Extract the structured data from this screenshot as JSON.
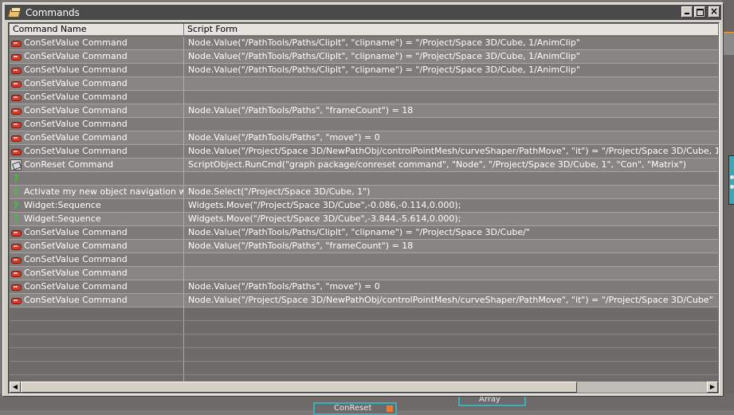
{
  "window": {
    "title": "Commands"
  },
  "table": {
    "columns": [
      "Command Name",
      "Script Form"
    ],
    "rows": [
      {
        "icon": "con",
        "name": "ConSetValue Command",
        "script": "Node.Value(\"/PathTools/Paths/ClipIt\", \"clipname\") = \"/Project/Space 3D/Cube, 1/AnimClip\""
      },
      {
        "icon": "con",
        "name": "ConSetValue Command",
        "script": "Node.Value(\"/PathTools/Paths/ClipIt\", \"clipname\") = \"/Project/Space 3D/Cube, 1/AnimClip\""
      },
      {
        "icon": "con",
        "name": "ConSetValue Command",
        "script": "Node.Value(\"/PathTools/Paths/ClipIt\", \"clipname\") = \"/Project/Space 3D/Cube, 1/AnimClip\""
      },
      {
        "icon": "con",
        "name": "ConSetValue Command",
        "script": ""
      },
      {
        "icon": "con",
        "name": "ConSetValue Command",
        "script": ""
      },
      {
        "icon": "con",
        "name": "ConSetValue Command",
        "script": "Node.Value(\"/PathTools/Paths\", \"frameCount\") = 18"
      },
      {
        "icon": "con",
        "name": "ConSetValue Command",
        "script": ""
      },
      {
        "icon": "con",
        "name": "ConSetValue Command",
        "script": "Node.Value(\"/PathTools/Paths\", \"move\") = 0"
      },
      {
        "icon": "con",
        "name": "ConSetValue Command",
        "script": "Node.Value(\"/Project/Space 3D/NewPathObj/controlPointMesh/curveShaper/PathMove\", \"it\") = \"/Project/Space 3D/Cube, 1\""
      },
      {
        "icon": "reset",
        "name": "ConReset Command",
        "script": "ScriptObject.RunCmd(\"graph package/conreset command\", \"Node\", \"/Project/Space 3D/Cube, 1\", \"Con\", \"Matrix\")"
      },
      {
        "icon": "q",
        "name": "",
        "script": ""
      },
      {
        "icon": "q",
        "name": "Activate my new object navigation widget",
        "script": "Node.Select(\"/Project/Space 3D/Cube, 1\")"
      },
      {
        "icon": "q",
        "name": "Widget:Sequence",
        "script": "Widgets.Move(\"/Project/Space 3D/Cube\",-0.086,-0.114,0.000);"
      },
      {
        "icon": "q",
        "name": "Widget:Sequence",
        "script": "Widgets.Move(\"/Project/Space 3D/Cube\",-3.844,-5.614,0.000);"
      },
      {
        "icon": "con",
        "name": "ConSetValue Command",
        "script": "Node.Value(\"/PathTools/Paths/ClipIt\", \"clipname\") = \"/Project/Space 3D/Cube/\""
      },
      {
        "icon": "con",
        "name": "ConSetValue Command",
        "script": "Node.Value(\"/PathTools/Paths\", \"frameCount\") = 18"
      },
      {
        "icon": "con",
        "name": "ConSetValue Command",
        "script": ""
      },
      {
        "icon": "con",
        "name": "ConSetValue Command",
        "script": ""
      },
      {
        "icon": "con",
        "name": "ConSetValue Command",
        "script": "Node.Value(\"/PathTools/Paths\", \"move\") = 0"
      },
      {
        "icon": "con",
        "name": "ConSetValue Command",
        "script": "Node.Value(\"/Project/Space 3D/NewPathObj/controlPointMesh/curveShaper/PathMove\", \"it\") = \"/Project/Space 3D/Cube\""
      }
    ],
    "empty_rows": 6
  },
  "background": {
    "node_array_label": "Array",
    "node_bottom_label": "ConReset"
  },
  "icons": {
    "window": "commands-window-icon",
    "con": "con-command-icon",
    "reset": "reset-command-icon",
    "q": "question-mark-icon"
  },
  "colors": {
    "titlebar": "#4a4a4a",
    "row_odd": "#7f7a7a",
    "row_even": "#8a8585",
    "question_icon": "#3ec43a",
    "con_icon": "#d63a2a",
    "node_border": "#3bb0b8"
  }
}
